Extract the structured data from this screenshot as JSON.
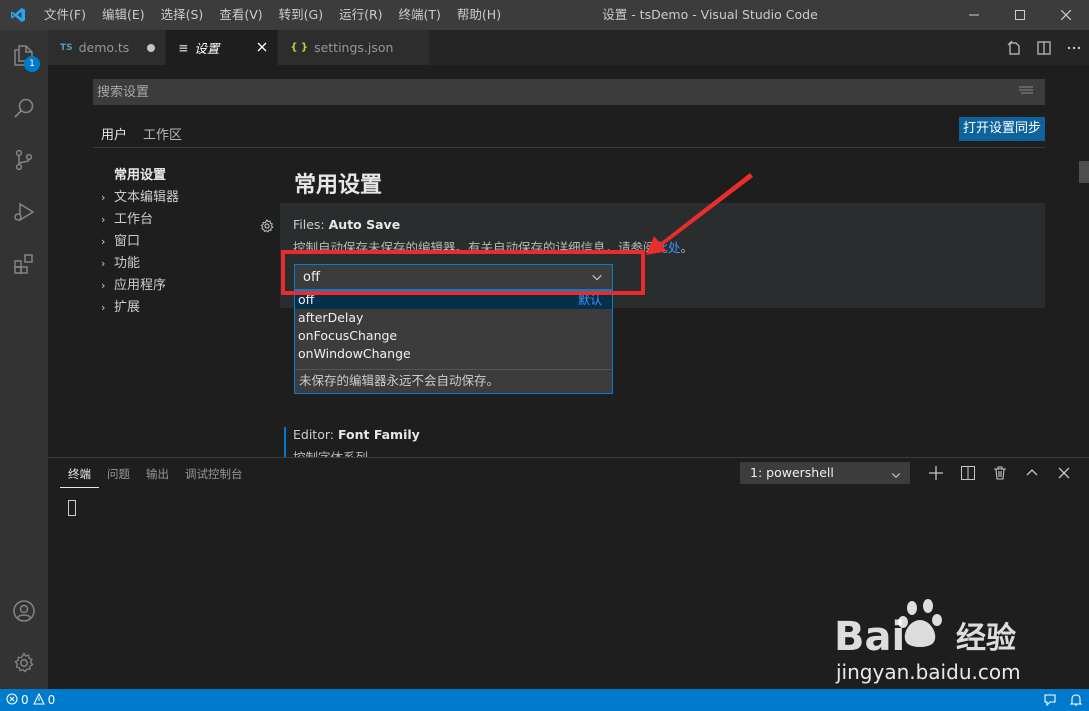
{
  "titlebar": {
    "menu": [
      "文件(F)",
      "编辑(E)",
      "选择(S)",
      "查看(V)",
      "转到(G)",
      "运行(R)",
      "终端(T)",
      "帮助(H)"
    ],
    "title": "设置 - tsDemo - Visual Studio Code"
  },
  "activitybar": {
    "badge": "1"
  },
  "tabs": [
    {
      "icon": "TS",
      "label": "demo.ts"
    },
    {
      "icon": "≡",
      "label": "设置"
    },
    {
      "icon": "{ }",
      "label": "settings.json"
    }
  ],
  "settings": {
    "search_placeholder": "搜索设置",
    "scopes": [
      "用户",
      "工作区"
    ],
    "sync_button": "打开设置同步",
    "toc": [
      "常用设置",
      "文本编辑器",
      "工作台",
      "窗口",
      "功能",
      "应用程序",
      "扩展"
    ],
    "section_title": "常用设置",
    "auto_save": {
      "category": "Files: ",
      "name": "Auto Save",
      "description": "控制自动保存未保存的编辑器。有关自动保存的详细信息，请参阅",
      "link": "此处",
      "period": "。",
      "value": "off",
      "options": [
        "off",
        "afterDelay",
        "onFocusChange",
        "onWindowChange"
      ],
      "default_label": "默认",
      "option_description": "未保存的编辑器永远不会自动保存。"
    },
    "font_family": {
      "category": "Editor: ",
      "name": "Font Family",
      "description": "控制字体系列。"
    }
  },
  "panel": {
    "tabs": [
      "终端",
      "问题",
      "输出",
      "调试控制台"
    ],
    "terminal_select": "1: powershell"
  },
  "statusbar": {
    "errors": "0",
    "warnings": "0"
  },
  "watermark": {
    "text": "jingyan.baidu.com"
  },
  "colors": {
    "accent": "#007acc",
    "highlight_box": "#ea2c2c"
  }
}
